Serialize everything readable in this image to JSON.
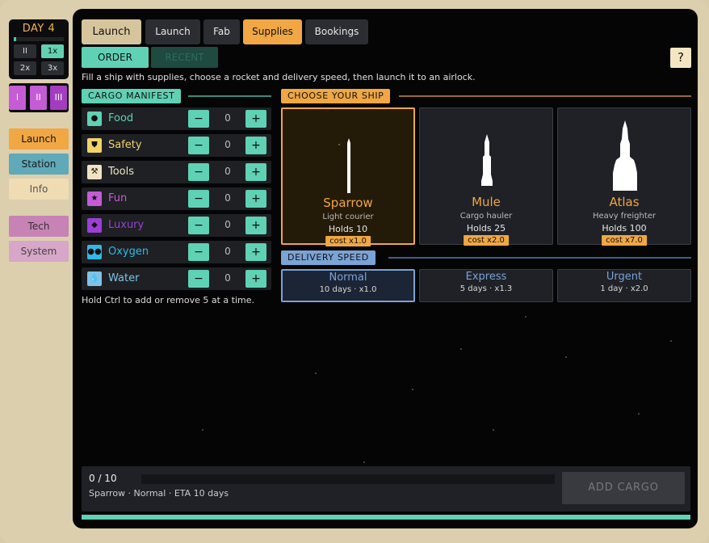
{
  "sidebar": {
    "day": "DAY 4",
    "day_progress": 0.05,
    "speeds": [
      "II",
      "1x",
      "2x",
      "3x"
    ],
    "speed_active": "1x",
    "levels": [
      "I",
      "II",
      "III"
    ],
    "nav": [
      {
        "label": "Launch",
        "bg": "#f0a744",
        "fg": "#111111"
      },
      {
        "label": "Station",
        "bg": "#5fa9b8",
        "fg": "#1a1a1a"
      },
      {
        "label": "Info",
        "bg": "#efdcb3",
        "fg": "#555555"
      },
      {
        "label": "Tech",
        "bg": "#c783b6",
        "fg": "#333333"
      },
      {
        "label": "System",
        "bg": "#d8a6c8",
        "fg": "#444444"
      }
    ]
  },
  "tabs": [
    "Launch",
    "Launch",
    "Fab",
    "Supplies",
    "Bookings"
  ],
  "subtabs": [
    "ORDER",
    "RECENT"
  ],
  "help": "?",
  "hint": "Fill a ship with supplies, choose a rocket and delivery speed, then launch it to an airlock.",
  "manifest": {
    "title": "CARGO MANIFEST",
    "items": [
      {
        "name": "Food",
        "color": "#5fd1b4",
        "icon": "apple-icon",
        "glyph": "●",
        "qty": "0"
      },
      {
        "name": "Safety",
        "color": "#f0d46a",
        "icon": "shield-icon",
        "glyph": "⛊",
        "qty": "0"
      },
      {
        "name": "Tools",
        "color": "#efe3c2",
        "icon": "wrench-icon",
        "glyph": "⚒",
        "qty": "0"
      },
      {
        "name": "Fun",
        "color": "#c45cd6",
        "icon": "star-icon",
        "glyph": "★",
        "qty": "0"
      },
      {
        "name": "Luxury",
        "color": "#9b3fd6",
        "icon": "gem-icon",
        "glyph": "◆",
        "qty": "0"
      },
      {
        "name": "Oxygen",
        "color": "#31b8e8",
        "icon": "bubbles-icon",
        "glyph": "●●",
        "qty": "0"
      },
      {
        "name": "Water",
        "color": "#7fc3e8",
        "icon": "droplet-icon",
        "glyph": "💧",
        "qty": "0"
      }
    ],
    "minus": "−",
    "plus": "+",
    "footer": "Hold Ctrl to add or remove 5 at a time."
  },
  "ships": {
    "title": "CHOOSE YOUR SHIP",
    "items": [
      {
        "name": "Sparrow",
        "desc": "Light courier",
        "holds": "Holds 10",
        "cost": "cost x1.0",
        "icon": "rocket-sparrow-icon"
      },
      {
        "name": "Mule",
        "desc": "Cargo hauler",
        "holds": "Holds 25",
        "cost": "cost x2.0",
        "icon": "rocket-mule-icon"
      },
      {
        "name": "Atlas",
        "desc": "Heavy freighter",
        "holds": "Holds 100",
        "cost": "cost x7.0",
        "icon": "rocket-atlas-icon"
      }
    ],
    "selected": "Sparrow"
  },
  "delivery": {
    "title": "DELIVERY SPEED",
    "items": [
      {
        "name": "Normal",
        "detail": "10 days · x1.0"
      },
      {
        "name": "Express",
        "detail": "5 days · x1.3"
      },
      {
        "name": "Urgent",
        "detail": "1 day · x2.0"
      }
    ],
    "selected": "Normal"
  },
  "footer": {
    "count": "0 / 10",
    "fill": 0,
    "summary": "Sparrow · Normal · ETA 10 days",
    "add_button": "ADD CARGO"
  }
}
